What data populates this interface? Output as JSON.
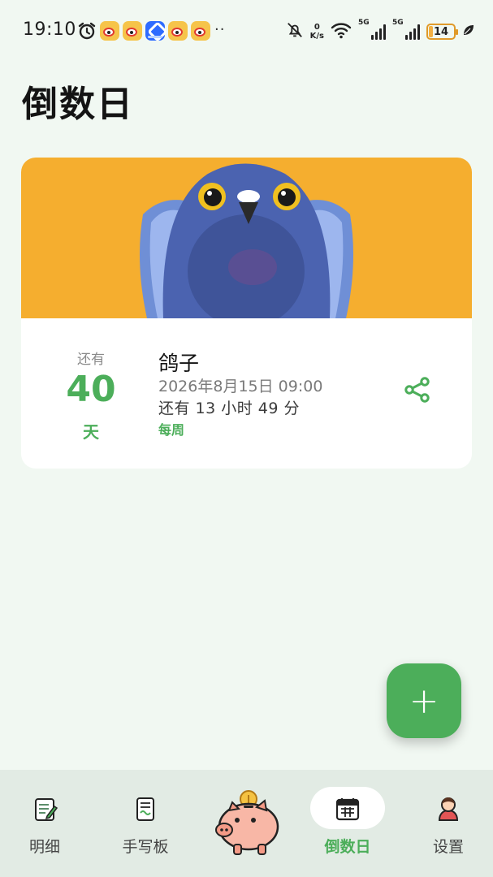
{
  "status_bar": {
    "time": "19:10",
    "notification_icons": [
      "alarm-icon",
      "weibo-icon",
      "weibo-icon",
      "app-icon",
      "weibo-icon",
      "weibo-icon"
    ],
    "more_indicator": "··",
    "net_speed_value": "0",
    "net_speed_unit": "K/s",
    "signal_1_label": "5G",
    "signal_2_label": "5G",
    "battery": "14"
  },
  "page": {
    "title": "倒数日"
  },
  "event_card": {
    "remain_label": "还有",
    "days": "40",
    "day_unit": "天",
    "name": "鸽子",
    "datetime": "2026年8月15日 09:00",
    "countdown": "还有 13 小时 49 分",
    "repeat": "每周",
    "banner_color": "#f5ae2f"
  },
  "fab": {
    "label": "+"
  },
  "bottom_nav": {
    "items": [
      {
        "label": "明细",
        "icon": "ledger-icon"
      },
      {
        "label": "手写板",
        "icon": "notepad-icon"
      },
      {
        "label": "",
        "icon": "piggy-bank-icon"
      },
      {
        "label": "倒数日",
        "icon": "calendar-icon",
        "active": true
      },
      {
        "label": "设置",
        "icon": "user-avatar-icon"
      }
    ]
  },
  "colors": {
    "accent": "#4cae5a",
    "background": "#f1f8f2",
    "nav_background": "#e2ebe4"
  }
}
